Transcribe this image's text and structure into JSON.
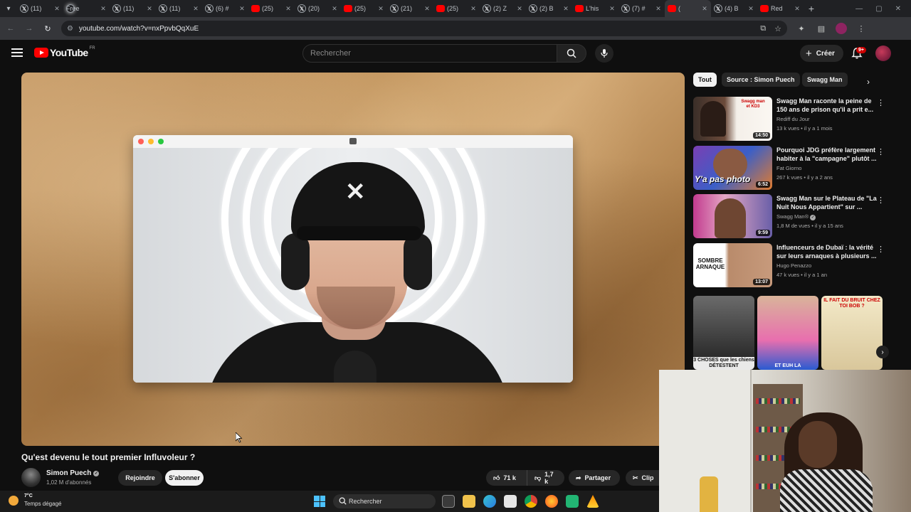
{
  "browser": {
    "tabs": [
      {
        "title": "(11) ",
        "icon": "x-icon"
      },
      {
        "title": "Free ",
        "icon": "ring-icon"
      },
      {
        "title": "(11) ",
        "icon": "x-icon"
      },
      {
        "title": "(11) ",
        "icon": "x-icon"
      },
      {
        "title": "(6) #",
        "icon": "x-icon"
      },
      {
        "title": "(25) ",
        "icon": "youtube-icon"
      },
      {
        "title": "(20) ",
        "icon": "x-icon"
      },
      {
        "title": "(25) ",
        "icon": "youtube-icon"
      },
      {
        "title": "(21) ",
        "icon": "x-icon"
      },
      {
        "title": "(25) ",
        "icon": "youtube-icon"
      },
      {
        "title": "(2) Z",
        "icon": "x-icon"
      },
      {
        "title": "(2) B",
        "icon": "x-icon"
      },
      {
        "title": "L'his",
        "icon": "youtube-icon"
      },
      {
        "title": "(7) #",
        "icon": "x-icon"
      },
      {
        "title": "(",
        "icon": "youtube-icon",
        "active": true
      },
      {
        "title": "(4) B",
        "icon": "x-icon"
      },
      {
        "title": "Red",
        "icon": "red-square-icon"
      }
    ],
    "url": "youtube.com/watch?v=nxPpvbQqXuE"
  },
  "header": {
    "logo_text": "YouTube",
    "country_code": "FR",
    "search_placeholder": "Rechercher",
    "create_label": "Créer",
    "notifications_badge": "9+"
  },
  "video": {
    "title": "Qu'est devenu le tout premier Influvoleur ?",
    "channel_name": "Simon Puech",
    "subscribers": "1,02 M d'abonnés",
    "join_label": "Rejoindre",
    "subscribe_label": "S'abonner",
    "likes": "71 k",
    "dislikes": "1,7 k",
    "share_label": "Partager",
    "clip_label": "Clip"
  },
  "sidebar": {
    "chips": [
      "Tout",
      "Source : Simon Puech",
      "Swagg Man"
    ],
    "recommendations": [
      {
        "title": "Swagg Man raconte la peine de 150 ans de prison qu'il a prit e...",
        "channel": "Rediff du Jour",
        "meta": "13 k vues • il y a 1 mois",
        "duration": "14:50"
      },
      {
        "title": "Pourquoi JDG préfère largement habiter à la \"campagne\" plutôt ...",
        "channel": "Fat Giorno",
        "meta": "267 k vues • il y a 2 ans",
        "duration": "6:52"
      },
      {
        "title": "Swagg Man sur le Plateau de \"La Nuit Nous Appartient\" sur ...",
        "channel": "Swagg Man®",
        "meta": "1,8 M de vues • il y a 15 ans",
        "duration": "9:59"
      },
      {
        "title": "Influenceurs de Dubaï : la vérité sur leurs arnaques à plusieurs ...",
        "channel": "Hugo Penazzo",
        "meta": "47 k vues • il y a 1 an",
        "duration": "13:07"
      }
    ],
    "thumb_texts": {
      "t1": "Swagg man et KD3",
      "t2": "Y'a pas photo",
      "t4": "SOMBRE ARNAQUE"
    },
    "shorts": [
      {
        "caption": "3 CHOSES que les chiens DÉTESTENT"
      },
      {
        "caption": "ET EUH LA"
      },
      {
        "caption": "IL FAIT DU BRUIT CHEZ TOI BOB ?"
      }
    ]
  },
  "taskbar": {
    "temperature": "7°C",
    "weather": "Temps dégagé",
    "search_label": "Rechercher"
  }
}
